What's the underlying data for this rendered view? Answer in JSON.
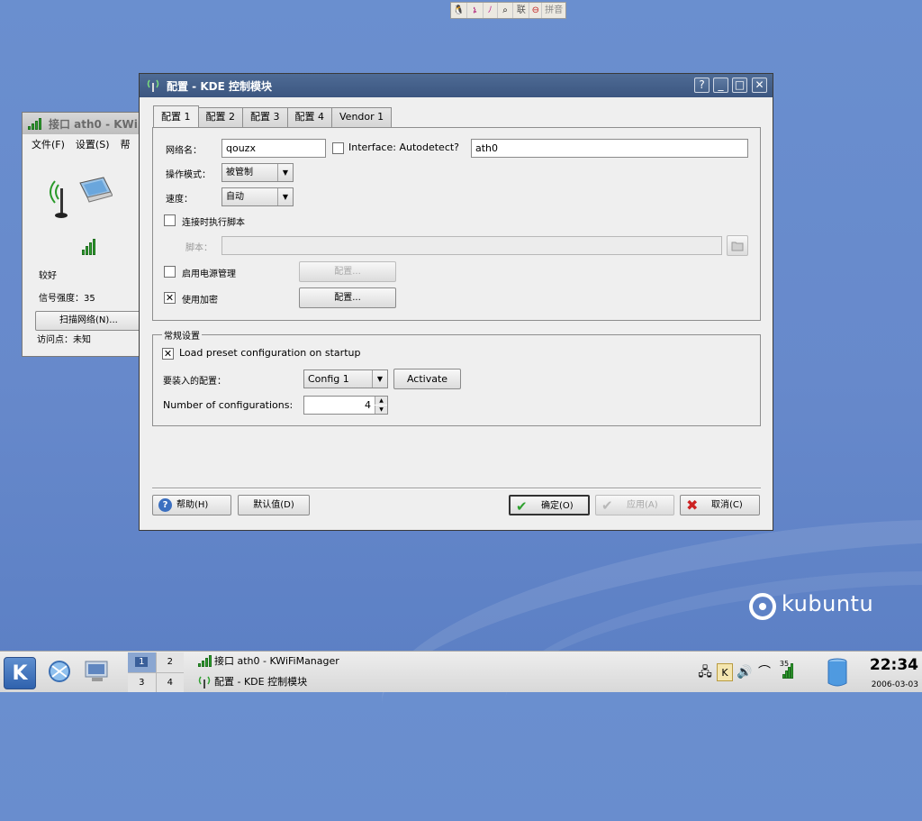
{
  "desktop": {
    "brand": "kubuntu"
  },
  "ime_bar": {
    "items": [
      "🐧",
      "ኔ",
      "ﾉ",
      "⌕",
      "联",
      "⊖",
      "拼音"
    ]
  },
  "bg_window": {
    "title": "接口 ath0 - KWiFiManager",
    "title_visible": "接口 ath0 - KWi",
    "menu": [
      "文件(F)",
      "设置(S)",
      "帮"
    ],
    "quality": "较好",
    "signal_label": "信号强度：35",
    "scan_button": "扫描网络(N)...",
    "ap_label": "访问点：未知"
  },
  "dialog": {
    "title": "配置 - KDE 控制模块",
    "tabs": [
      "配置 1",
      "配置 2",
      "配置 3",
      "配置 4",
      "Vendor 1"
    ],
    "network_name_label": "网络名：",
    "network_name_value": "qouzx",
    "autodetect_label": "Interface: Autodetect?",
    "interface_value": "ath0",
    "mode_label": "操作模式：",
    "mode_value": "被管制",
    "speed_label": "速度：",
    "speed_value": "自动",
    "run_script_label": "连接时执行脚本",
    "script_label": "脚本：",
    "power_label": "启用电源管理",
    "power_button": "配置...",
    "encrypt_label": "使用加密",
    "encrypt_checked": true,
    "encrypt_button": "配置...",
    "general_group": "常规设置",
    "load_preset_label": "Load preset configuration on startup",
    "load_preset_checked": true,
    "config_to_load_label": "要装入的配置：",
    "config_to_load_value": "Config 1",
    "activate_button": "Activate",
    "num_configs_label": "Number of configurations:",
    "num_configs_value": "4",
    "help_button": "帮助(H)",
    "defaults_button": "默认值(D)",
    "ok_button": "确定(O)",
    "apply_button": "应用(A)",
    "cancel_button": "取消(C)"
  },
  "taskbar": {
    "start_label": "K",
    "pager": [
      "1",
      "2",
      "3",
      "4"
    ],
    "active_desktop": "1",
    "tasks": [
      "接口 ath0 - KWiFiManager",
      "配置 - KDE 控制模块"
    ],
    "signal_badge": "35",
    "time": "22:34",
    "date": "2006-03-03"
  },
  "colors": {
    "desktop": "#6789cb",
    "titlebar": "#45618a",
    "accent_green": "#2fa12f",
    "cancel_red": "#cc2222"
  }
}
